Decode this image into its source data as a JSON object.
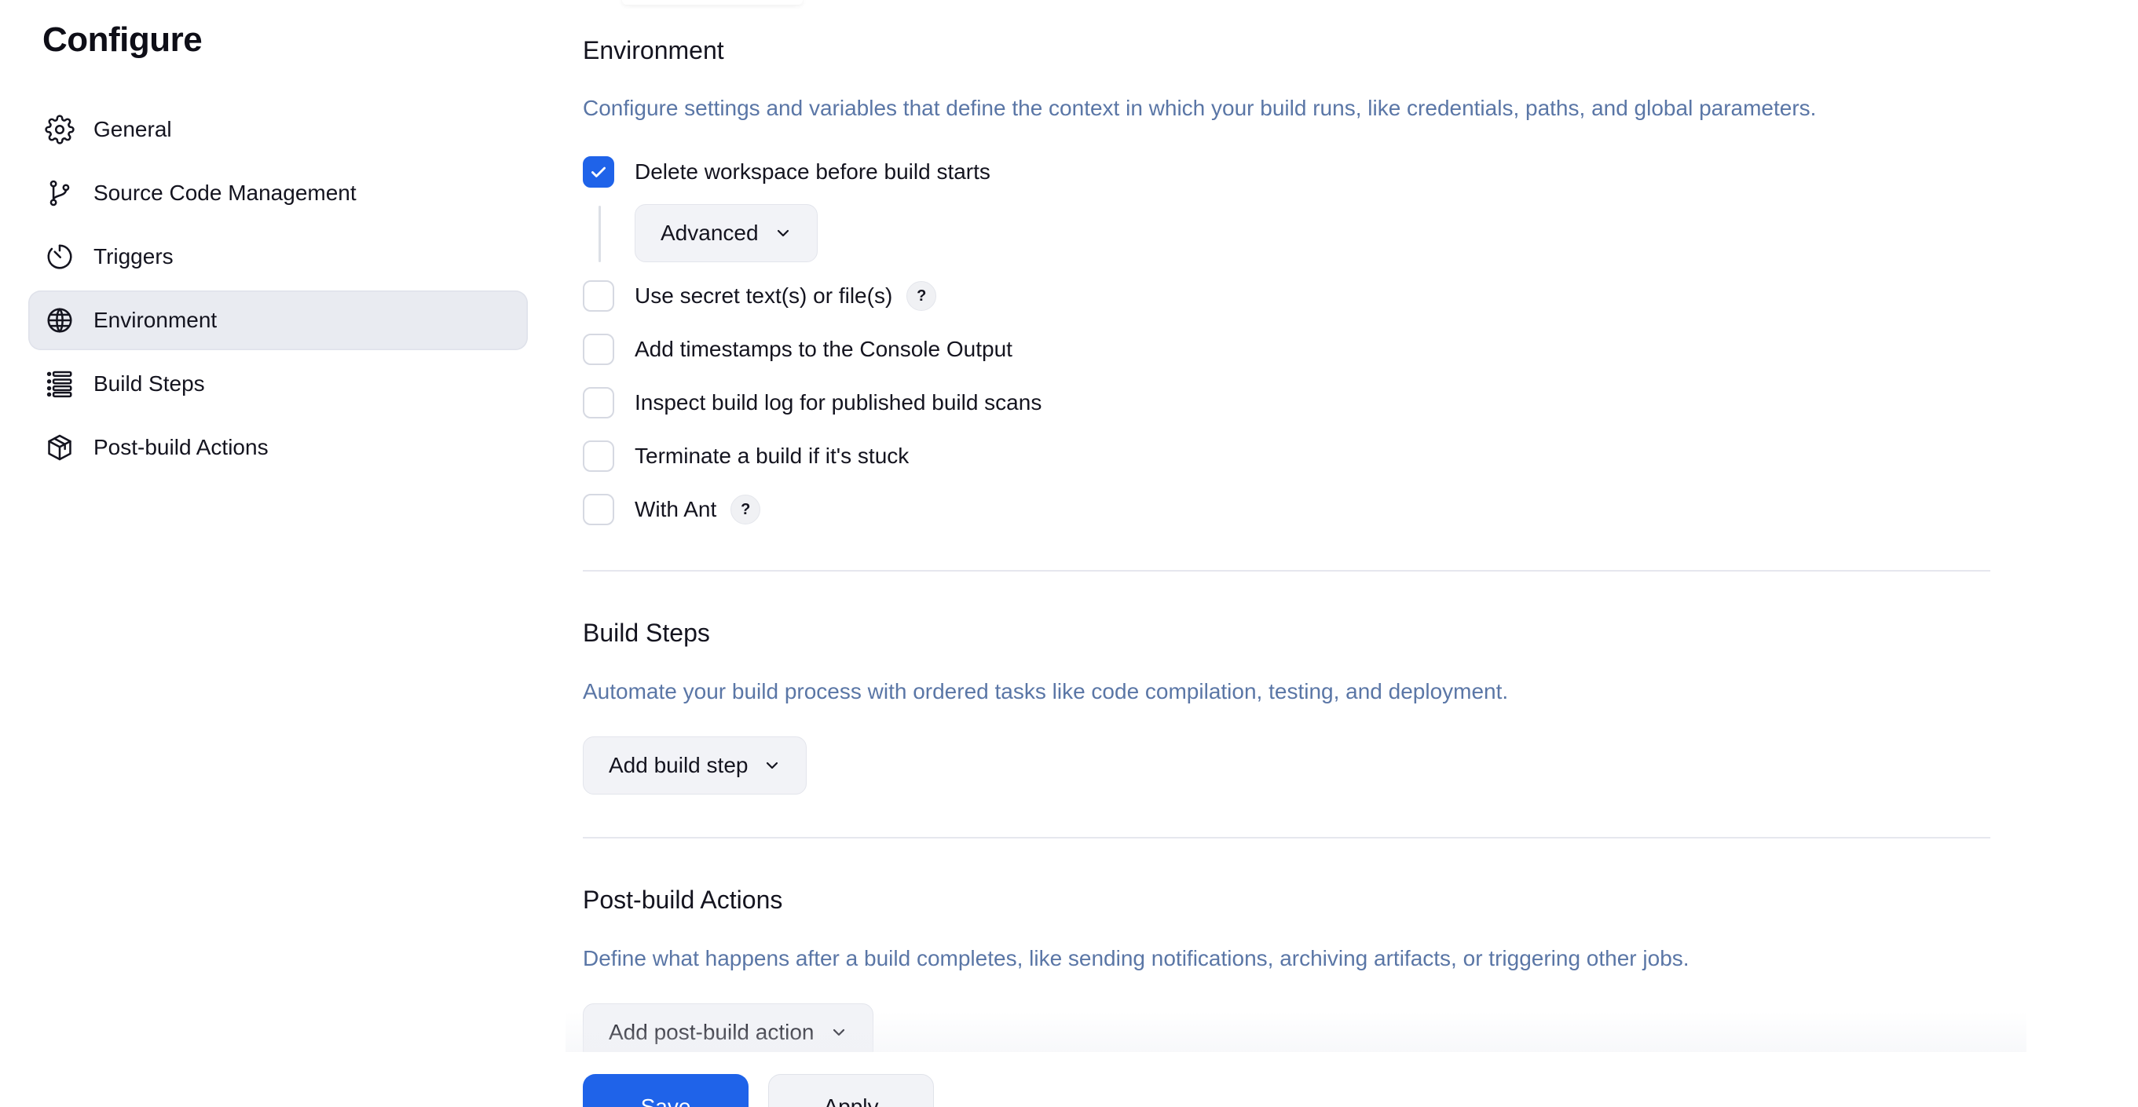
{
  "sidebar": {
    "title": "Configure",
    "items": [
      {
        "label": "General",
        "icon": "gear-icon",
        "active": false
      },
      {
        "label": "Source Code Management",
        "icon": "git-branch-icon",
        "active": false
      },
      {
        "label": "Triggers",
        "icon": "timer-icon",
        "active": false
      },
      {
        "label": "Environment",
        "icon": "globe-icon",
        "active": true
      },
      {
        "label": "Build Steps",
        "icon": "list-icon",
        "active": false
      },
      {
        "label": "Post-build Actions",
        "icon": "package-icon",
        "active": false
      }
    ]
  },
  "environment": {
    "title": "Environment",
    "description": "Configure settings and variables that define the context in which your build runs, like credentials, paths, and global parameters.",
    "options": [
      {
        "label": "Delete workspace before build starts",
        "checked": true,
        "help": false
      },
      {
        "label": "Use secret text(s) or file(s)",
        "checked": false,
        "help": true
      },
      {
        "label": "Add timestamps to the Console Output",
        "checked": false,
        "help": false
      },
      {
        "label": "Inspect build log for published build scans",
        "checked": false,
        "help": false
      },
      {
        "label": "Terminate a build if it's stuck",
        "checked": false,
        "help": false
      },
      {
        "label": "With Ant",
        "checked": false,
        "help": true
      }
    ],
    "advanced_label": "Advanced",
    "help_glyph": "?"
  },
  "build_steps": {
    "title": "Build Steps",
    "description": "Automate your build process with ordered tasks like code compilation, testing, and deployment.",
    "add_label": "Add build step"
  },
  "post_build": {
    "title": "Post-build Actions",
    "description": "Define what happens after a build completes, like sending notifications, archiving artifacts, or triggering other jobs.",
    "add_label": "Add post-build action"
  },
  "footer": {
    "save_label": "Save",
    "apply_label": "Apply"
  },
  "colors": {
    "accent": "#1f63e9",
    "description_text": "#5a76a6",
    "active_nav_bg": "#e9ebf1"
  }
}
